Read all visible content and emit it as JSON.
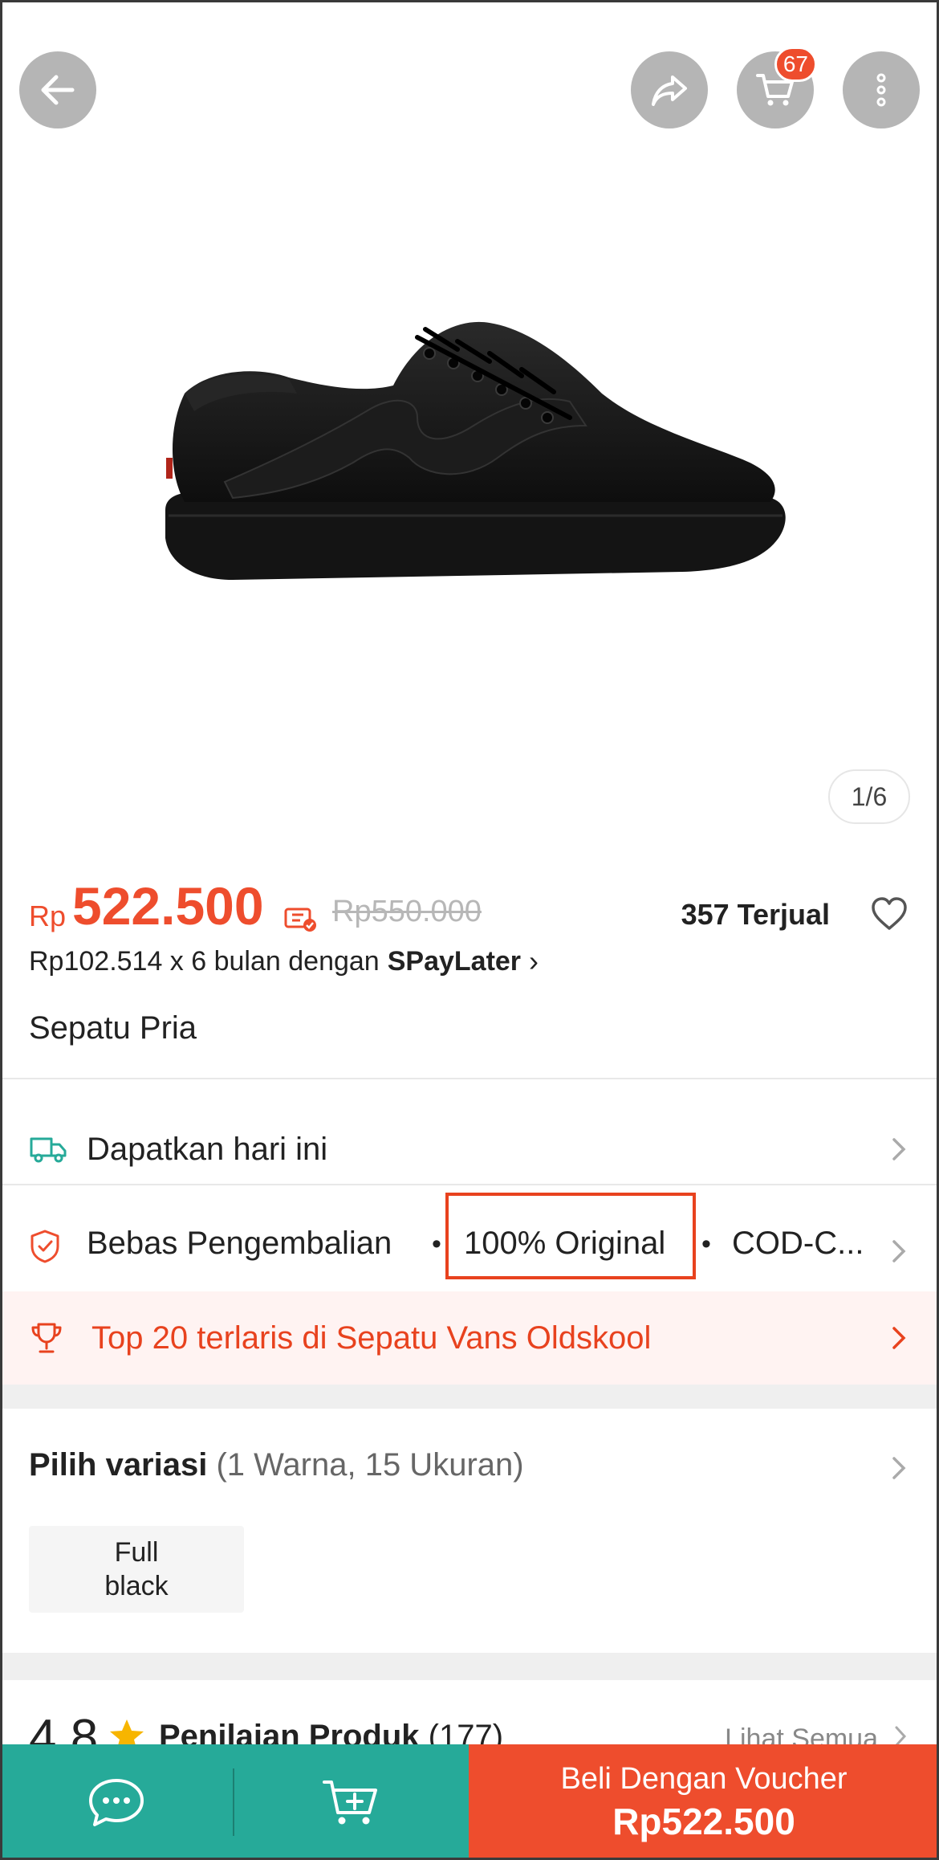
{
  "header": {
    "cart_badge": "67"
  },
  "gallery": {
    "indicator": "1/6"
  },
  "price": {
    "currency": "Rp",
    "value": "522.500",
    "original": "Rp550.000",
    "sold": "357 Terjual"
  },
  "paylater": {
    "prefix": "Rp102.514 x 6 bulan dengan",
    "brand": "SPayLater",
    "chevron": "›"
  },
  "product": {
    "name": "Sepatu Pria"
  },
  "shipping": {
    "label": "Dapatkan hari ini"
  },
  "guarantees": {
    "items": [
      "Bebas Pengembalian",
      "100% Original",
      "COD-C..."
    ],
    "separator": "•"
  },
  "top_rank": {
    "label": "Top 20 terlaris di Sepatu Vans Oldskool"
  },
  "variation": {
    "title": "Pilih variasi",
    "subtitle": "(1 Warna, 15 Ukuran)",
    "option_line1": "Full",
    "option_line2": "black"
  },
  "rating": {
    "value": "4.8",
    "label": "Penilaian Produk",
    "count": "(177)",
    "see_all": "Lihat Semua"
  },
  "bottom_bar": {
    "buy_label": "Beli Dengan Voucher",
    "buy_price": "Rp522.500"
  },
  "colors": {
    "accent": "#ee4d2d",
    "teal": "#26aa99",
    "highlight_box": "#e8421e"
  },
  "icons": [
    "back-arrow-icon",
    "share-icon",
    "cart-icon",
    "more-vertical-icon",
    "voucher-icon",
    "heart-icon",
    "truck-icon",
    "shield-check-icon",
    "trophy-icon",
    "chevron-right-icon",
    "star-icon",
    "chat-icon",
    "add-to-cart-icon"
  ]
}
